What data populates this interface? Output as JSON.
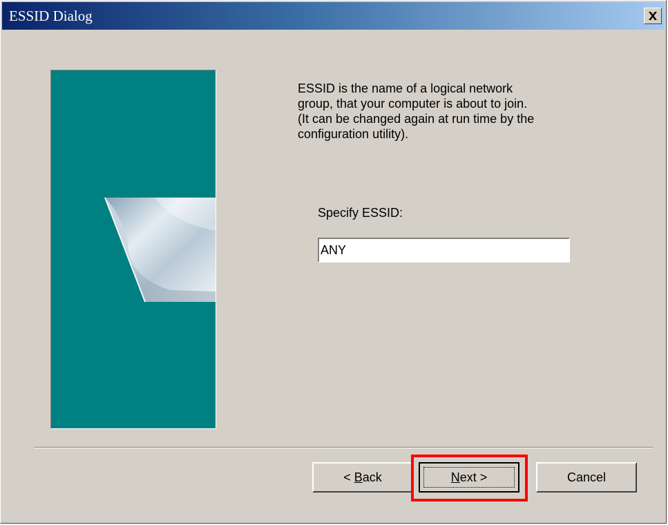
{
  "window": {
    "title": "ESSID Dialog",
    "close_icon": "close-icon"
  },
  "content": {
    "description": "ESSID is the name of a logical network\ngroup, that your computer is about to join.\n(It can be changed again at run time by the\nconfiguration utility).",
    "essid_label": "Specify ESSID:",
    "essid_value": "ANY"
  },
  "buttons": {
    "back": {
      "prefix": "< ",
      "mnemonic": "B",
      "rest": "ack"
    },
    "next": {
      "mnemonic": "N",
      "rest": "ext >"
    },
    "cancel": "Cancel"
  },
  "colors": {
    "titlebar_start": "#0a246a",
    "titlebar_end": "#a6caf0",
    "side_panel": "#008080",
    "highlight": "#ff0000",
    "dialog_face": "#d4d0c8"
  }
}
